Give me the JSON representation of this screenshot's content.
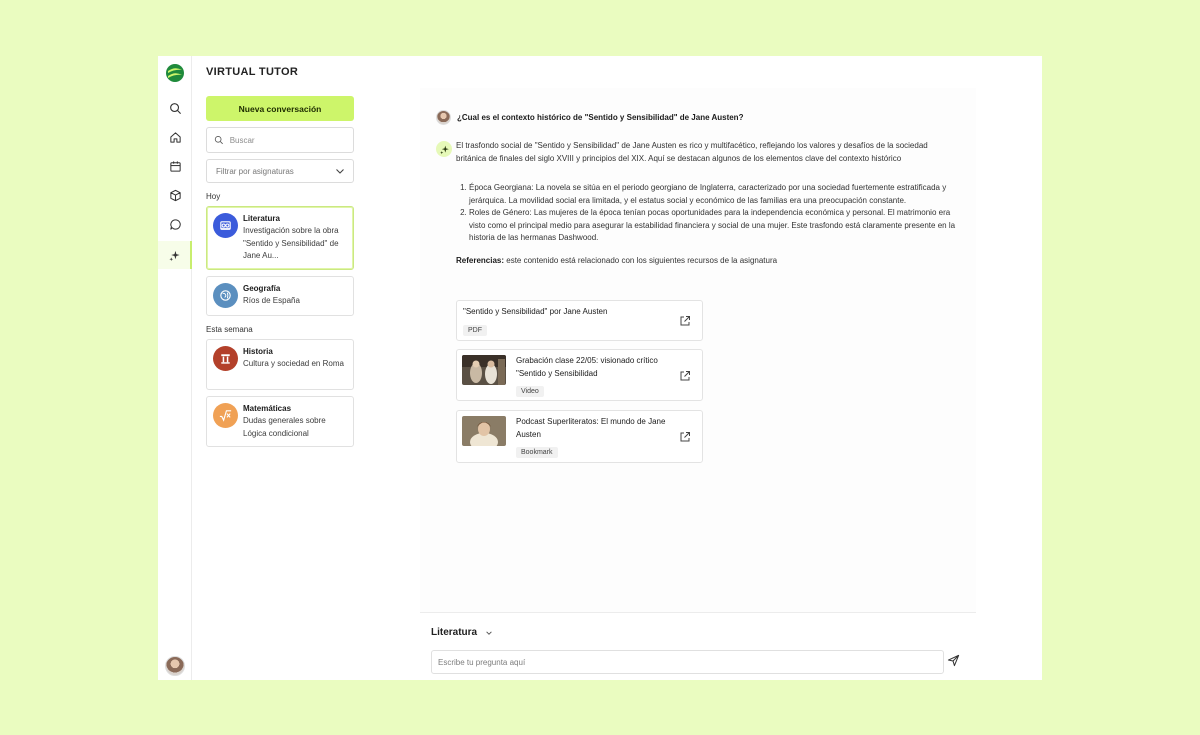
{
  "app": {
    "title": "VIRTUAL TUTOR",
    "accent": "#cdf56a"
  },
  "rail": {
    "items": [
      {
        "icon": "search-icon"
      },
      {
        "icon": "home-icon"
      },
      {
        "icon": "calendar-icon"
      },
      {
        "icon": "cube-icon"
      },
      {
        "icon": "chat-bubble-icon"
      },
      {
        "icon": "sparkle-icon",
        "active": true
      }
    ]
  },
  "sidebar": {
    "new_conversation": "Nueva conversación",
    "search_placeholder": "Buscar",
    "filter_label": "Filtrar por asignaturas",
    "today_label": "Hoy",
    "week_label": "Esta semana",
    "conversations": [
      {
        "title": "Literatura",
        "subtitle": "Investigación sobre la obra \"Sentido y Sensibilidad\" de Jane Au...",
        "icon": "book-icon",
        "color": "#3b5bdb"
      },
      {
        "title": "Geografía",
        "subtitle": "Ríos de España",
        "icon": "globe-icon",
        "color": "#5b8fbf"
      },
      {
        "title": "Historia",
        "subtitle": "Cultura y sociedad en Roma",
        "icon": "column-icon",
        "color": "#b3402a"
      },
      {
        "title": "Matemáticas",
        "subtitle": "Dudas generales sobre Lógica condicional",
        "icon": "sqrt-icon",
        "color": "#f0a155"
      }
    ]
  },
  "chat": {
    "question": "¿Cual es el contexto histórico  de \"Sentido y Sensibilidad\" de Jane Austen?",
    "answer_intro": "El trasfondo social de \"Sentido y Sensibilidad\" de Jane Austen es rico y multifacético, reflejando los valores y desafíos de la sociedad británica de finales del siglo XVIII y principios del XIX. Aquí se destacan algunos de los elementos clave del contexto histórico",
    "points": [
      "Época Georgiana: La novela se sitúa en el periodo georgiano de Inglaterra, caracterizado por una sociedad fuertemente estratificada y jerárquica. La movilidad social era limitada, y el estatus social y económico de las familias era una preocupación constante.",
      "Roles de Género: Las mujeres de la época tenían pocas oportunidades para la independencia económica y personal. El matrimonio era visto como el principal medio para asegurar la estabilidad financiera y social de una mujer. Este trasfondo está claramente presente en la historia de las hermanas Dashwood."
    ],
    "refs_label": "Referencias:",
    "refs_text": " este contenido está relacionado con los siguientes recursos de la asignatura",
    "resources": [
      {
        "title": "\"Sentido y Sensibilidad\" por Jane Austen",
        "tag": "PDF"
      },
      {
        "title": "Grabación clase 22/05: visionado crítico \"Sentido y Sensibilidad",
        "tag": "Video"
      },
      {
        "title": "Podcast Superliteratos: El mundo de Jane Austen",
        "tag": "Bookmark"
      }
    ]
  },
  "composer": {
    "subject": "Literatura",
    "placeholder": "Escribe tu pregunta aquí"
  }
}
